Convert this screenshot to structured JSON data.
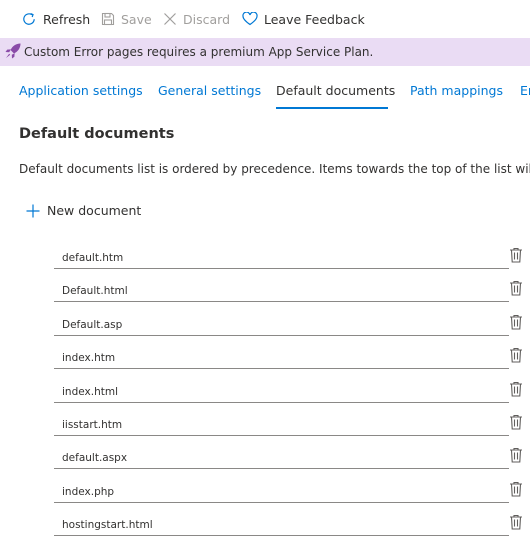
{
  "toolbar": {
    "refresh_label": "Refresh",
    "save_label": "Save",
    "discard_label": "Discard",
    "feedback_label": "Leave Feedback"
  },
  "banner": {
    "text": "Custom Error pages requires a premium App Service Plan.",
    "icon": "rocket-icon"
  },
  "tabs": [
    {
      "label": "Application settings",
      "active": false
    },
    {
      "label": "General settings",
      "active": false
    },
    {
      "label": "Default documents",
      "active": true
    },
    {
      "label": "Path mappings",
      "active": false
    },
    {
      "label": "Error pages",
      "active": false
    }
  ],
  "section": {
    "title": "Default documents",
    "description": "Default documents list is ordered by precedence. Items towards the top of the list will have higher precedence."
  },
  "new_document_label": "New document",
  "documents": [
    "default.htm",
    "Default.html",
    "Default.asp",
    "index.htm",
    "index.html",
    "iisstart.htm",
    "default.aspx",
    "index.php",
    "hostingstart.html"
  ],
  "colors": {
    "accent": "#0078d4",
    "banner_bg": "#eadcf4",
    "banner_icon": "#8a4ba8",
    "text": "#323130",
    "disabled": "#a19f9d"
  }
}
